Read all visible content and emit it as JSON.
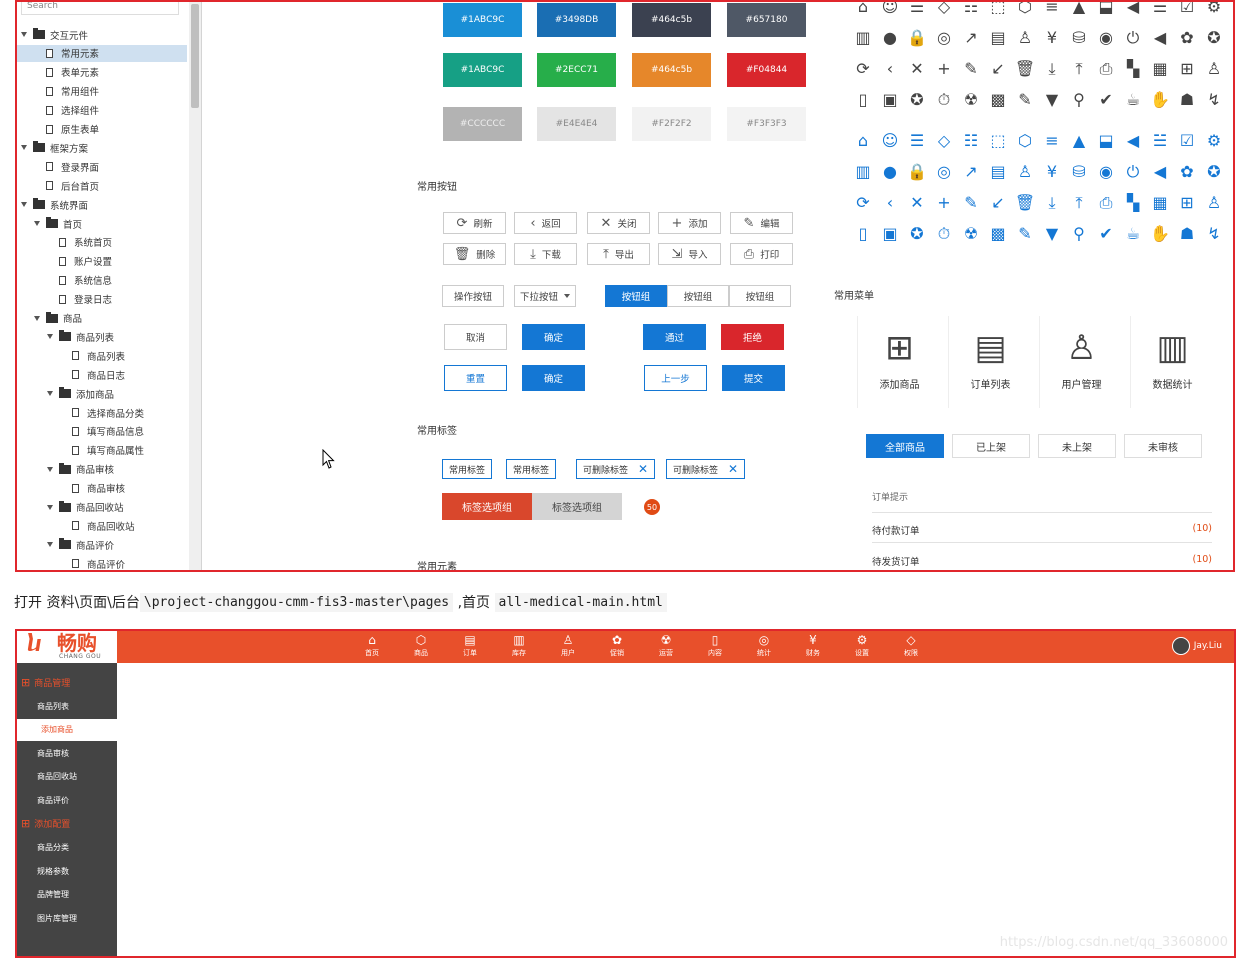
{
  "sidebar": {
    "search_placeholder": "Search",
    "items": [
      {
        "label": "交互元件",
        "type": "folder",
        "level": 0
      },
      {
        "label": "常用元素",
        "type": "doc",
        "level": 1,
        "selected": true
      },
      {
        "label": "表单元素",
        "type": "doc",
        "level": 1
      },
      {
        "label": "常用组件",
        "type": "doc",
        "level": 1
      },
      {
        "label": "选择组件",
        "type": "doc",
        "level": 1
      },
      {
        "label": "原生表单",
        "type": "doc",
        "level": 1
      },
      {
        "label": "框架方案",
        "type": "folder",
        "level": 0
      },
      {
        "label": "登录界面",
        "type": "doc",
        "level": 1
      },
      {
        "label": "后台首页",
        "type": "doc",
        "level": 1
      },
      {
        "label": "系统界面",
        "type": "folder",
        "level": 0
      },
      {
        "label": "首页",
        "type": "folder",
        "level": 1
      },
      {
        "label": "系统首页",
        "type": "doc",
        "level": 2
      },
      {
        "label": "账户设置",
        "type": "doc",
        "level": 2
      },
      {
        "label": "系统信息",
        "type": "doc",
        "level": 2
      },
      {
        "label": "登录日志",
        "type": "doc",
        "level": 2
      },
      {
        "label": "商品",
        "type": "folder",
        "level": 1
      },
      {
        "label": "商品列表",
        "type": "folder",
        "level": 2
      },
      {
        "label": "商品列表",
        "type": "doc",
        "level": 3
      },
      {
        "label": "商品日志",
        "type": "doc",
        "level": 3
      },
      {
        "label": "添加商品",
        "type": "folder",
        "level": 2
      },
      {
        "label": "选择商品分类",
        "type": "doc",
        "level": 3
      },
      {
        "label": "填写商品信息",
        "type": "doc",
        "level": 3
      },
      {
        "label": "填写商品属性",
        "type": "doc",
        "level": 3
      },
      {
        "label": "商品审核",
        "type": "folder",
        "level": 2
      },
      {
        "label": "商品审核",
        "type": "doc",
        "level": 3
      },
      {
        "label": "商品回收站",
        "type": "folder",
        "level": 2
      },
      {
        "label": "商品回收站",
        "type": "doc",
        "level": 3
      },
      {
        "label": "商品评价",
        "type": "folder",
        "level": 2
      },
      {
        "label": "商品评价",
        "type": "doc",
        "level": 3
      }
    ]
  },
  "swatches": [
    {
      "label": "#1ABC9C",
      "color": "#1a8fd6"
    },
    {
      "label": "#3498DB",
      "color": "#1a6eb3"
    },
    {
      "label": "#464c5b",
      "color": "#3b4150"
    },
    {
      "label": "#657180",
      "color": "#4f5866"
    },
    {
      "label": "#1ABC9C",
      "color": "#16a085"
    },
    {
      "label": "#2ECC71",
      "color": "#27ae4a"
    },
    {
      "label": "#464c5b",
      "color": "#e6872a"
    },
    {
      "label": "#F04844",
      "color": "#d9262c"
    },
    {
      "label": "#CCCCCC",
      "color": "#b3b3b3"
    },
    {
      "label": "#E4E4E4",
      "color": "#e4e4e4"
    },
    {
      "label": "#F2F2F2",
      "color": "#f2f2f2"
    },
    {
      "label": "#F3F3F3",
      "color": "#f3f3f3"
    }
  ],
  "sections": {
    "buttons": "常用按钮",
    "tags": "常用标签",
    "elements": "常用元素",
    "menu": "常用菜单"
  },
  "icon_buttons": [
    {
      "label": "刷新",
      "icon": "⟳"
    },
    {
      "label": "返回",
      "icon": "‹"
    },
    {
      "label": "关闭",
      "icon": "✕"
    },
    {
      "label": "添加",
      "icon": "+"
    },
    {
      "label": "编辑",
      "icon": "✎"
    },
    {
      "label": "删除",
      "icon": "🗑"
    },
    {
      "label": "下载",
      "icon": "⤓"
    },
    {
      "label": "导出",
      "icon": "⤒"
    },
    {
      "label": "导入",
      "icon": "⇲"
    },
    {
      "label": "打印",
      "icon": "⎙"
    }
  ],
  "row3": {
    "op_button": "操作按钮",
    "dropdown_button": "下拉按钮",
    "group": [
      "按钮组",
      "按钮组",
      "按钮组"
    ]
  },
  "row4": [
    "取消",
    "确定",
    "通过",
    "拒绝"
  ],
  "row5": [
    "重置",
    "确定",
    "上一步",
    "提交"
  ],
  "tags": {
    "plain": [
      "常用标签",
      "常用标签"
    ],
    "closable": [
      "可删除标签",
      "可删除标签"
    ],
    "tab_active": "标签选项组",
    "tab_inactive": "标签选项组",
    "badge": "50"
  },
  "icon_rows_gray": [
    [
      "⌂",
      "☺",
      "☰",
      "◇",
      "☷",
      "⬚",
      "⬡",
      "≡",
      "▲",
      "⬓",
      "◀",
      "☱",
      "☑",
      "⚙"
    ],
    [
      "▥",
      "●",
      "🔒",
      "◎",
      "↗",
      "▤",
      "♙",
      "¥",
      "⛁",
      "◉",
      "⏻",
      "◀",
      "✿",
      "✪"
    ],
    [
      "⟳",
      "‹",
      "✕",
      "+",
      "✎",
      "↙",
      "🗑",
      "⤓",
      "⤒",
      "⎙",
      "▚",
      "▦",
      "⊞",
      "♙"
    ],
    [
      "▯",
      "▣",
      "✪",
      "⏱",
      "☢",
      "▩",
      "✎",
      "▼",
      "⚲",
      "✔",
      "☕",
      "✋",
      "☗",
      "↯"
    ]
  ],
  "icon_rows_blue": [
    [
      "⌂",
      "☺",
      "☰",
      "◇",
      "☷",
      "⬚",
      "⬡",
      "≡",
      "▲",
      "⬓",
      "◀",
      "☱",
      "☑",
      "⚙"
    ],
    [
      "▥",
      "●",
      "🔒",
      "◎",
      "↗",
      "▤",
      "♙",
      "¥",
      "⛁",
      "◉",
      "⏻",
      "◀",
      "✿",
      "✪"
    ],
    [
      "⟳",
      "‹",
      "✕",
      "+",
      "✎",
      "↙",
      "🗑",
      "⤓",
      "⤒",
      "⎙",
      "▚",
      "▦",
      "⊞",
      "♙"
    ],
    [
      "▯",
      "▣",
      "✪",
      "⏱",
      "☢",
      "▩",
      "✎",
      "▼",
      "⚲",
      "✔",
      "☕",
      "✋",
      "☗",
      "↯"
    ]
  ],
  "menu_cards": [
    {
      "label": "添加商品",
      "icon": "⊞"
    },
    {
      "label": "订单列表",
      "icon": "▤"
    },
    {
      "label": "用户管理",
      "icon": "♙"
    },
    {
      "label": "数据统计",
      "icon": "▥"
    }
  ],
  "menu_tabs": [
    "全部商品",
    "已上架",
    "未上架",
    "未审核"
  ],
  "order": {
    "title": "订单提示",
    "rows": [
      {
        "label": "待付款订单",
        "count": "(10)"
      },
      {
        "label": "待发货订单",
        "count": "(10)"
      }
    ]
  },
  "caption": {
    "prefix": "打开",
    "path_cn": "资料\\页面\\后台",
    "path_code": "\\project-changgou-cmm-fis3-master\\pages",
    "sep": ",首页",
    "file": "all-medical-main.html"
  },
  "app": {
    "logo_cn": "畅购",
    "logo_en": "CHANG GOU",
    "nav": [
      {
        "label": "首页",
        "icon": "⌂"
      },
      {
        "label": "商品",
        "icon": "⬡"
      },
      {
        "label": "订单",
        "icon": "▤"
      },
      {
        "label": "库存",
        "icon": "▥"
      },
      {
        "label": "用户",
        "icon": "♙"
      },
      {
        "label": "促销",
        "icon": "✿"
      },
      {
        "label": "运营",
        "icon": "☢"
      },
      {
        "label": "内容",
        "icon": "▯"
      },
      {
        "label": "统计",
        "icon": "◎"
      },
      {
        "label": "财务",
        "icon": "¥"
      },
      {
        "label": "设置",
        "icon": "⚙"
      },
      {
        "label": "权限",
        "icon": "◇"
      }
    ],
    "user": "Jay.Liu",
    "left_groups": [
      {
        "label": "商品管理",
        "items": [
          "商品列表",
          "添加商品",
          "商品审核",
          "商品回收站",
          "商品评价"
        ],
        "active": 1
      },
      {
        "label": "添加配置",
        "items": [
          "商品分类",
          "规格参数",
          "品牌管理",
          "图片库管理"
        ]
      }
    ],
    "watermark": "https://blog.csdn.net/qq_33608000"
  }
}
